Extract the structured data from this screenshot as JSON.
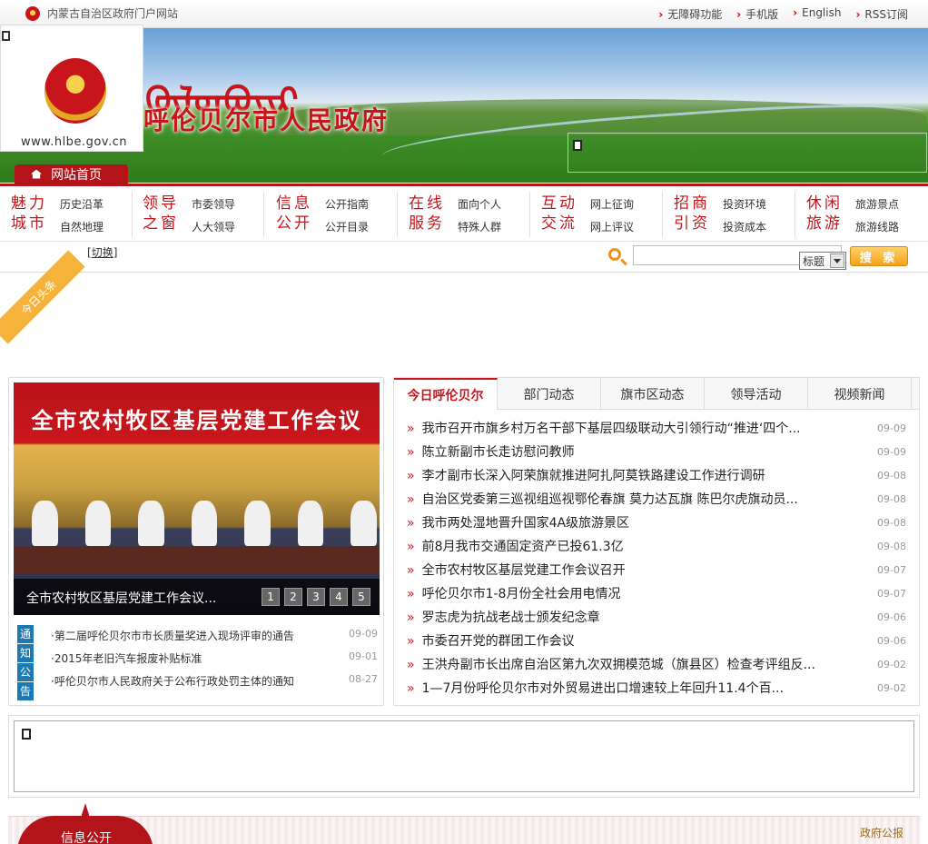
{
  "topbar": {
    "site_name": "内蒙古自治区政府门户网站",
    "links": [
      "无障碍功能",
      "手机版",
      "English",
      "RSS订阅"
    ]
  },
  "banner": {
    "mongolian_title": "ᠬᠥᠯᠥᠨᠪᠤᠶᠢᠷ",
    "title": "呼伦贝尔市人民政府",
    "url": "www.hlbe.gov.cn",
    "home_label": "网站首页"
  },
  "nav": [
    {
      "cat": [
        "魅力",
        "城市"
      ],
      "subs": [
        "历史沿革",
        "自然地理"
      ]
    },
    {
      "cat": [
        "领导",
        "之窗"
      ],
      "subs": [
        "市委领导",
        "人大领导"
      ]
    },
    {
      "cat": [
        "信息",
        "公开"
      ],
      "subs": [
        "公开指南",
        "公开目录"
      ]
    },
    {
      "cat": [
        "在线",
        "服务"
      ],
      "subs": [
        "面向个人",
        "特殊人群"
      ]
    },
    {
      "cat": [
        "互动",
        "交流"
      ],
      "subs": [
        "网上征询",
        "网上评议"
      ]
    },
    {
      "cat": [
        "招商",
        "引资"
      ],
      "subs": [
        "投资环境",
        "投资成本"
      ]
    },
    {
      "cat": [
        "休闲",
        "旅游"
      ],
      "subs": [
        "旅游景点",
        "旅游线路"
      ]
    }
  ],
  "search": {
    "switch_label": "切换",
    "select_value": "标题",
    "button_label": "搜 索"
  },
  "headline": {
    "ribbon": "今日头条"
  },
  "slider": {
    "banner_text": "全市农村牧区基层党建工作会议",
    "caption": "全市农村牧区基层党建工作会议...",
    "pages": [
      "1",
      "2",
      "3",
      "4",
      "5"
    ]
  },
  "notice": {
    "tag": [
      "通",
      "知",
      "公",
      "告"
    ],
    "items": [
      {
        "title": "·第二届呼伦贝尔市市长质量奖进入现场评审的通告",
        "date": "09-09"
      },
      {
        "title": "·2015年老旧汽车报废补贴标准",
        "date": "09-01"
      },
      {
        "title": "·呼伦贝尔市人民政府关于公布行政处罚主体的通知",
        "date": "08-27"
      }
    ]
  },
  "tabs": [
    "今日呼伦贝尔",
    "部门动态",
    "旗市区动态",
    "领导活动",
    "视频新闻"
  ],
  "news": [
    {
      "title": "我市召开市旗乡村万名干部下基层四级联动大引领行动“推进‘四个...",
      "date": "09-09"
    },
    {
      "title": "陈立新副市长走访慰问教师",
      "date": "09-09"
    },
    {
      "title": "李才副市长深入阿荣旗就推进阿扎阿莫铁路建设工作进行调研",
      "date": "09-08"
    },
    {
      "title": "自治区党委第三巡视组巡视鄂伦春旗 莫力达瓦旗 陈巴尔虎旗动员...",
      "date": "09-08"
    },
    {
      "title": "我市两处湿地晋升国家4A级旅游景区",
      "date": "09-08"
    },
    {
      "title": "前8月我市交通固定资产已投61.3亿",
      "date": "09-08"
    },
    {
      "title": "全市农村牧区基层党建工作会议召开",
      "date": "09-07"
    },
    {
      "title": "呼伦贝尔市1-8月份全社会用电情况",
      "date": "09-07"
    },
    {
      "title": "罗志虎为抗战老战士颁发纪念章",
      "date": "09-06"
    },
    {
      "title": "市委召开党的群团工作会议",
      "date": "09-06"
    },
    {
      "title": "王洪舟副市长出席自治区第九次双拥模范城（旗县区）检查考评组反...",
      "date": "09-02"
    },
    {
      "title": "1—7月份呼伦贝尔市对外贸易进出口增速较上年回升11.4个百...",
      "date": "09-02"
    }
  ],
  "info_section": {
    "label": "信息公开",
    "right_link": "政府公报"
  }
}
